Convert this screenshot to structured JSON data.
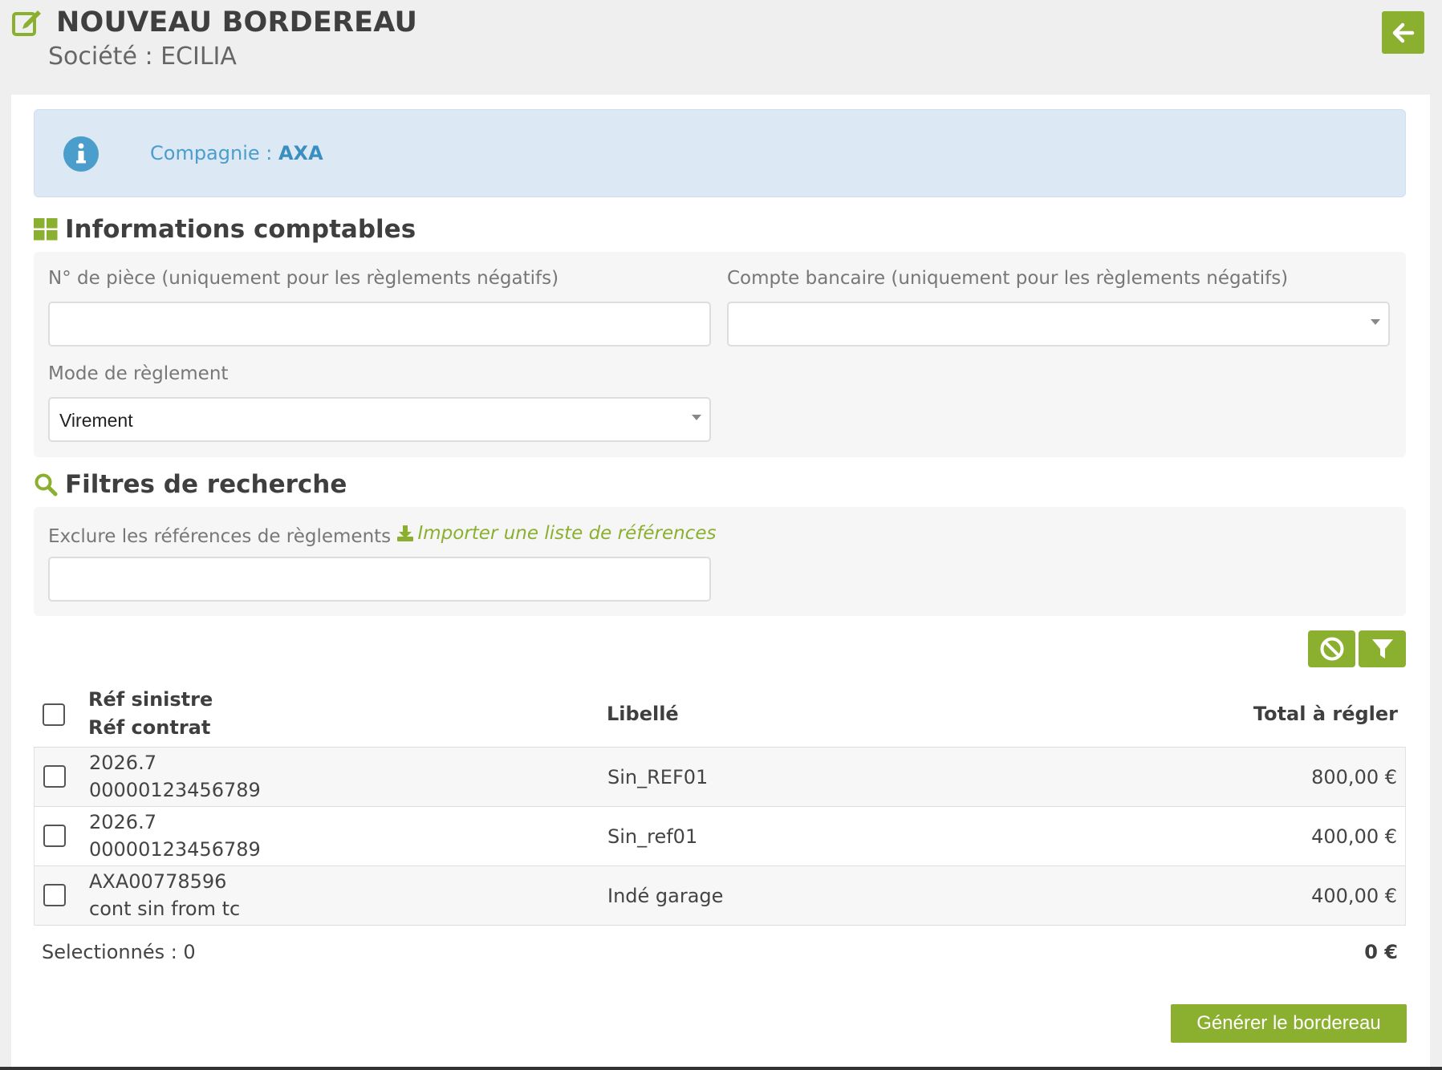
{
  "header": {
    "title": "NOUVEAU BORDEREAU",
    "subtitle": "Société : ECILIA",
    "edit_icon": "edit-icon",
    "back_icon": "arrow-left-icon"
  },
  "alert": {
    "label": "Compagnie : ",
    "value": "AXA"
  },
  "accounting": {
    "title": "Informations comptables",
    "piece_label": "N° de pièce (uniquement pour les règlements négatifs)",
    "piece_value": "",
    "bank_label": "Compte bancaire (uniquement pour les règlements négatifs)",
    "bank_value": "",
    "mode_label": "Mode de règlement",
    "mode_value": "Virement"
  },
  "filters": {
    "title": "Filtres de recherche",
    "exclude_label": "Exclure les références de règlements",
    "import_link": "Importer une liste de références",
    "exclude_value": ""
  },
  "table": {
    "headers": {
      "ref_sinistre": "Réf sinistre",
      "ref_contrat": "Réf contrat",
      "libelle": "Libellé",
      "total": "Total à régler"
    },
    "rows": [
      {
        "ref_sinistre": "2026.7",
        "ref_contrat": "00000123456789",
        "libelle": "Sin_REF01",
        "total": "800,00 €"
      },
      {
        "ref_sinistre": "2026.7",
        "ref_contrat": "00000123456789",
        "libelle": "Sin_ref01",
        "total": "400,00 €"
      },
      {
        "ref_sinistre": "AXA00778596",
        "ref_contrat": "cont sin from tc",
        "libelle": "Indé garage",
        "total": "400,00 €"
      }
    ],
    "footer": {
      "selected": "Selectionnés : 0",
      "total": "0 €"
    }
  },
  "actions": {
    "generate": "Générer le bordereau"
  },
  "colors": {
    "accent": "#8bb02f",
    "info_bg": "#dce9f5",
    "info_text": "#4b9dcb"
  }
}
